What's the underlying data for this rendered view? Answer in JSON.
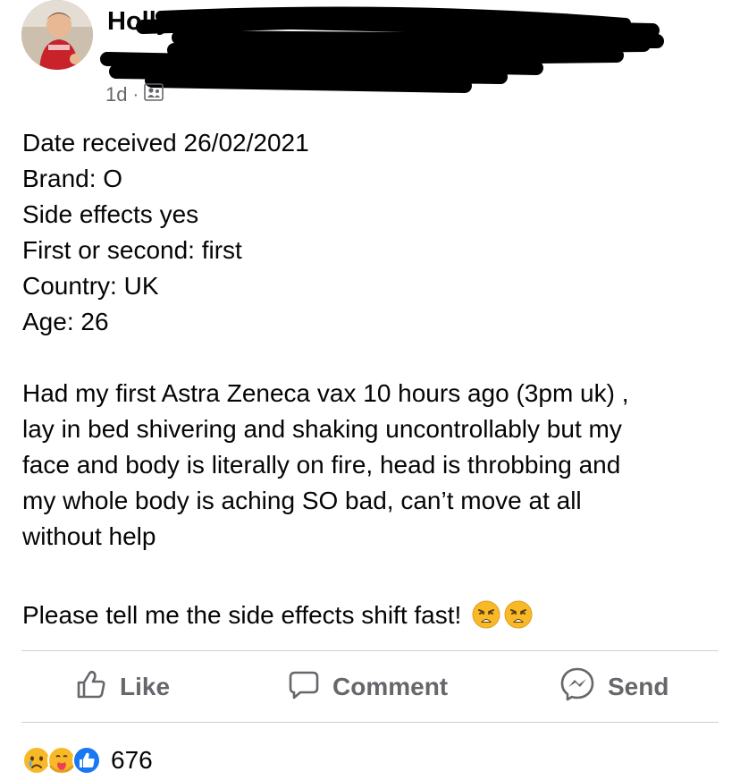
{
  "post": {
    "author_name": "Holly K",
    "meta": {
      "time": "1d",
      "separator": "·",
      "audience_icon": "friends-list-icon"
    },
    "details": [
      "Date received 26/02/2021",
      "Brand: O",
      "Side effects yes",
      "First or second: first",
      "Country: UK",
      "Age: 26"
    ],
    "story_lines": [
      "Had my first Astra Zeneca vax 10 hours ago (3pm uk) ,",
      "lay in bed shivering and shaking uncontrollably but my",
      "face and body is literally on fire, head is throbbing and",
      "my whole body is aching SO bad, can’t move at all",
      "without help"
    ],
    "closing": "Please tell me the side effects shift fast!",
    "closing_emojis": [
      "weary-face-emoji",
      "weary-face-emoji"
    ]
  },
  "actions": {
    "like_label": "Like",
    "comment_label": "Comment",
    "send_label": "Send"
  },
  "reactions": {
    "icons": [
      "sad-reaction-icon",
      "care-reaction-icon",
      "like-reaction-icon"
    ],
    "count": "676"
  },
  "colors": {
    "text": "#050505",
    "secondary_text": "#65676b",
    "divider": "#ced0d4",
    "like_blue": "#1877f2",
    "reaction_yellow": "#f7b928"
  }
}
